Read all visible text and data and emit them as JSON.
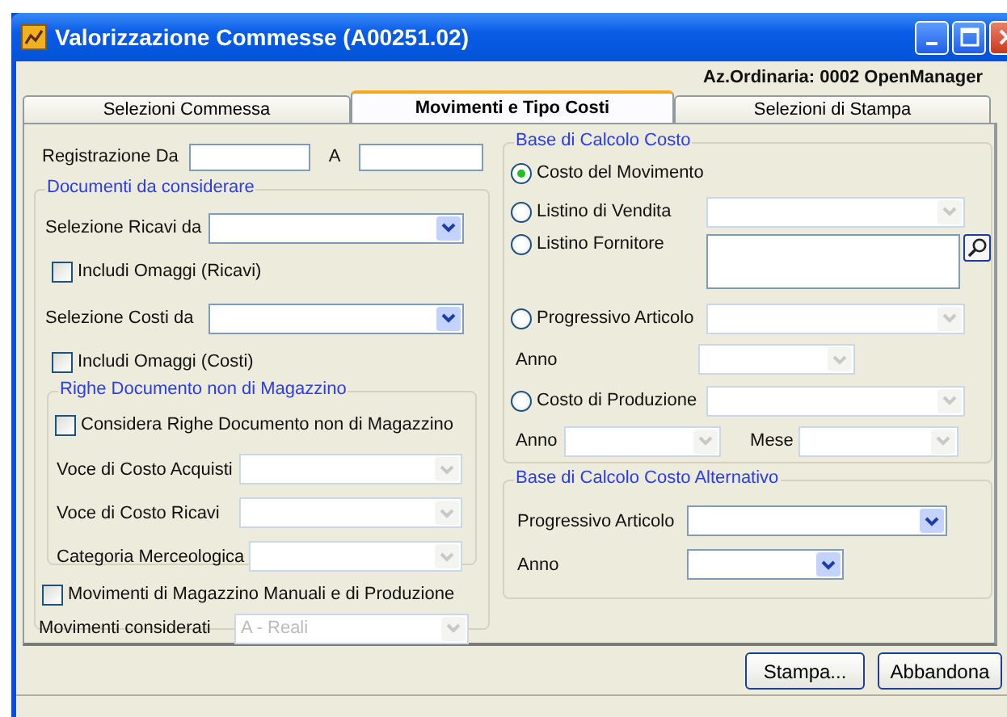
{
  "window": {
    "title": "Valorizzazione Commesse (A00251.02)"
  },
  "company": "Az.Ordinaria: 0002 OpenManager",
  "tabs": [
    {
      "label": "Selezioni Commessa",
      "selected": false
    },
    {
      "label": "Movimenti e Tipo Costi",
      "selected": true
    },
    {
      "label": "Selezioni di Stampa",
      "selected": false
    }
  ],
  "registrazione": {
    "label": "Registrazione Da",
    "to_label": "A"
  },
  "documenti": {
    "title": "Documenti da considerare",
    "rows": [
      {
        "kind": "combo",
        "label": "Selezione Ricavi da",
        "disabled": false
      },
      {
        "kind": "check",
        "label": "Includi Omaggi (Ricavi)",
        "checked": false
      },
      {
        "kind": "combo",
        "label": "Selezione Costi da",
        "disabled": false
      },
      {
        "kind": "check",
        "label": "Includi Omaggi (Costi)",
        "checked": false
      }
    ]
  },
  "righe": {
    "title": "Righe Documento non di Magazzino",
    "check": {
      "label": "Considera Righe Documento non di Magazzino",
      "checked": false
    },
    "rows": [
      {
        "label": "Voce di Costo Acquisti",
        "disabled": true
      },
      {
        "label": "Voce di Costo Ricavi",
        "disabled": true
      },
      {
        "label": "Categoria Merceologica",
        "disabled": true
      }
    ]
  },
  "movimenti_manuali": {
    "label": "Movimenti di Magazzino Manuali e di Produzione",
    "checked": false
  },
  "movimenti_considerati": {
    "label": "Movimenti considerati",
    "value": "A - Reali",
    "disabled": true
  },
  "base": {
    "title": "Base di Calcolo Costo",
    "rows": [
      {
        "kind": "radio",
        "label": "Costo del Movimento",
        "selected": true
      },
      {
        "kind": "radio_combo",
        "label": "Listino di Vendita",
        "selected": false
      },
      {
        "kind": "radio_lookup",
        "label": "Listino Fornitore",
        "selected": false
      },
      {
        "kind": "radio_combo",
        "label": "Progressivo Articolo",
        "selected": false
      },
      {
        "kind": "year",
        "label": "Anno"
      },
      {
        "kind": "radio_combo",
        "label": "Costo di Produzione",
        "selected": false
      },
      {
        "kind": "year_month",
        "label": "Anno",
        "month_label": "Mese"
      }
    ]
  },
  "alternativo": {
    "title": "Base di Calcolo Costo Alternativo",
    "rows": [
      {
        "kind": "wide_combo",
        "label": "Progressivo Articolo",
        "disabled": false
      },
      {
        "kind": "short_combo",
        "label": "Anno",
        "disabled": false
      }
    ]
  },
  "buttons": [
    "Stampa...",
    "Abbandona"
  ]
}
